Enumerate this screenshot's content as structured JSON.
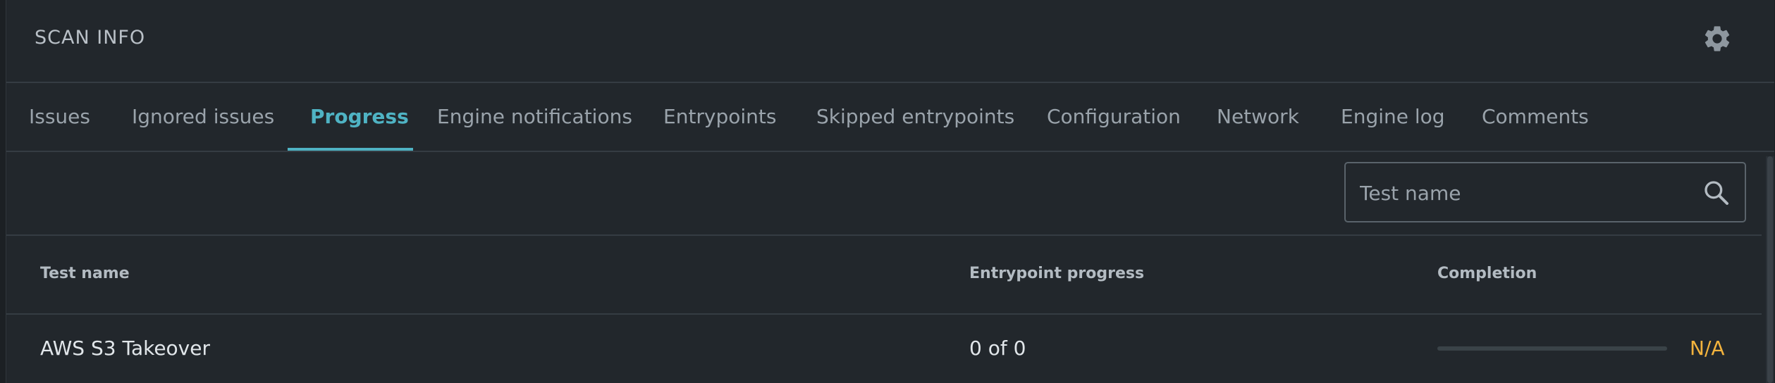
{
  "header": {
    "title": "SCAN INFO",
    "settings_icon": "gear-icon"
  },
  "tabs": [
    {
      "label": "Issues",
      "active": false
    },
    {
      "label": "Ignored issues",
      "active": false
    },
    {
      "label": "Progress",
      "active": true
    },
    {
      "label": "Engine notifications",
      "active": false
    },
    {
      "label": "Entrypoints",
      "active": false
    },
    {
      "label": "Skipped entrypoints",
      "active": false
    },
    {
      "label": "Configuration",
      "active": false
    },
    {
      "label": "Network",
      "active": false
    },
    {
      "label": "Engine log",
      "active": false
    },
    {
      "label": "Comments",
      "active": false
    }
  ],
  "search": {
    "placeholder": "Test name",
    "value": "",
    "icon": "search-icon"
  },
  "table": {
    "columns": [
      "Test name",
      "Entrypoint progress",
      "Completion"
    ],
    "rows": [
      {
        "test_name": "AWS S3 Takeover",
        "entrypoint_progress": "0 of 0",
        "completion_fraction": 0,
        "completion_label": "N/A"
      }
    ]
  },
  "colors": {
    "accent": "#4fb3c4",
    "warning": "#f3b33d",
    "background": "#22272c"
  }
}
